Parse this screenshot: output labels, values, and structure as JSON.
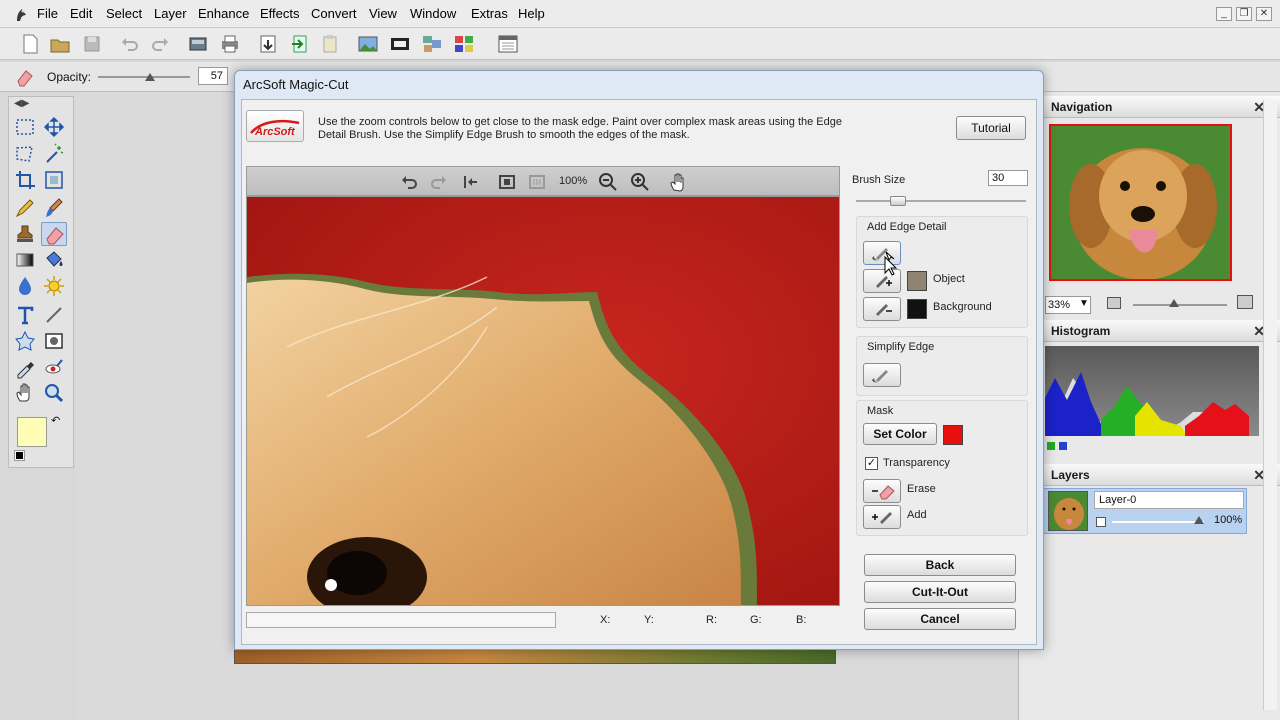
{
  "menu": {
    "items": [
      "File",
      "Edit",
      "Select",
      "Layer",
      "Enhance",
      "Effects",
      "Convert",
      "View",
      "Window",
      "Extras",
      "Help"
    ]
  },
  "icons": [
    "app-icon",
    "new-icon",
    "open-icon",
    "save-icon",
    "undo-icon",
    "redo-icon",
    "scan-icon",
    "print-icon",
    "import-icon",
    "export-icon",
    "clipboard-icon",
    "picture-icon",
    "film-icon",
    "collage-icon",
    "grid-icon",
    "calendar-icon",
    "eraser-icon"
  ],
  "options": {
    "opacity_label": "Opacity:",
    "opacity_value": "57",
    "opacity_level": 0.57
  },
  "dialog": {
    "title": "ArcSoft Magic-Cut",
    "logo": "ArcSoft",
    "instructions": "Use the zoom controls below to get close to the mask edge. Paint over complex mask areas using the Edge Detail Brush. Use the Simplify Edge Brush to smooth the edges of the mask.",
    "tutorial_label": "Tutorial",
    "zoom_value": "100%",
    "brush_size_label": "Brush Size",
    "brush_size_value": "30",
    "add_edge_detail_label": "Add Edge Detail",
    "object_label": "Object",
    "background_label": "Background",
    "simplify_edge_label": "Simplify Edge",
    "mask_label": "Mask",
    "set_color_label": "Set Color",
    "transparency_label": "Transparency",
    "erase_label": "Erase",
    "add_label": "Add",
    "back_label": "Back",
    "cut_label": "Cut-It-Out",
    "cancel_label": "Cancel",
    "readout": {
      "x": "X:",
      "y": "Y:",
      "r": "R:",
      "g": "G:",
      "b": "B:"
    },
    "colors": {
      "mask": "#e8100e",
      "object": "#8f8471",
      "background": "#111111"
    }
  },
  "panels": {
    "navigation": {
      "title": "Navigation",
      "zoom": "33%"
    },
    "histogram": {
      "title": "Histogram"
    },
    "layers": {
      "title": "Layers",
      "layer_name": "Layer-0",
      "opacity": "100%"
    }
  }
}
